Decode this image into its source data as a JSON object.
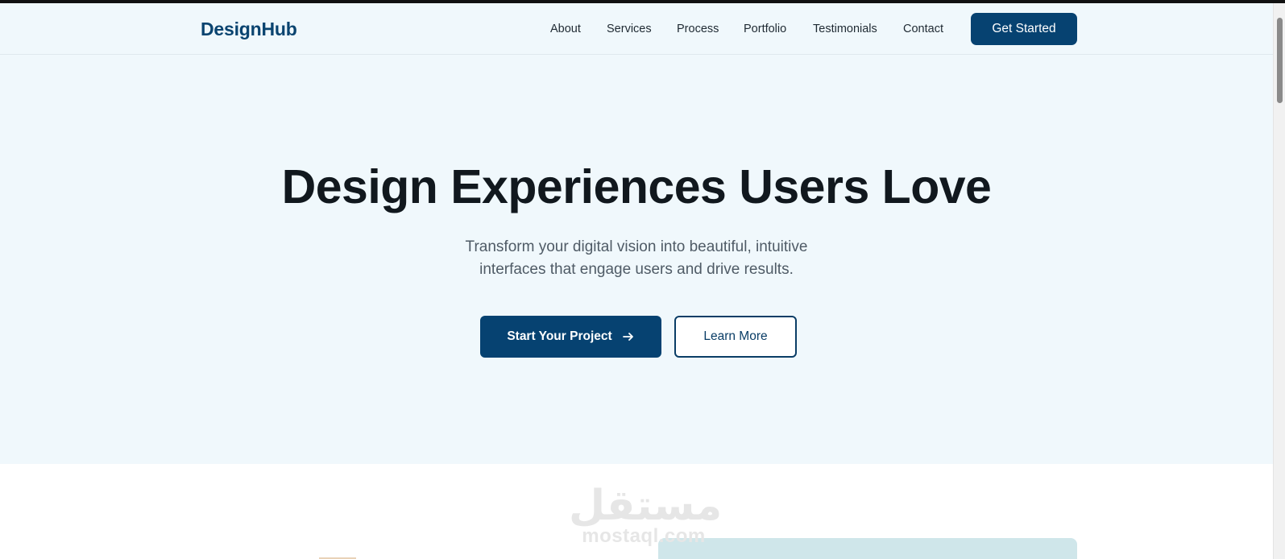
{
  "header": {
    "logo": "DesignHub",
    "nav": [
      "About",
      "Services",
      "Process",
      "Portfolio",
      "Testimonials",
      "Contact"
    ],
    "cta_label": "Get Started"
  },
  "hero": {
    "title": "Design Experiences Users Love",
    "subtitle_lines": [
      "Transform your digital vision into beautiful, intuitive",
      "interfaces that engage users and drive results."
    ],
    "primary_button": "Start Your Project",
    "secondary_button": "Learn More"
  },
  "watermark": {
    "arabic": "مستقل",
    "latin": "mostaql.com"
  },
  "icons": {
    "primary_button_icon": "arrow-right-icon"
  },
  "colors": {
    "brand": "#064271",
    "hero_background": "#f0f8fc",
    "heading": "#11181e",
    "body_text": "#4f5b66"
  }
}
